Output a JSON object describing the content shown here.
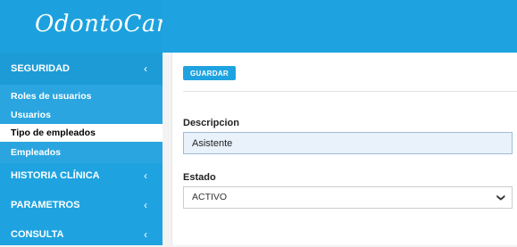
{
  "app": {
    "brand": "OdontoCandy"
  },
  "sidebar": {
    "sections": [
      {
        "label": "SEGURIDAD",
        "chevron": "‹"
      },
      {
        "label": "HISTORIA CLÍNICA",
        "chevron": "‹"
      },
      {
        "label": "PARAMETROS",
        "chevron": "‹"
      },
      {
        "label": "CONSULTA",
        "chevron": "‹"
      }
    ],
    "submenu": [
      {
        "label": "Roles de usuarios",
        "active": false
      },
      {
        "label": "Usuarios",
        "active": false
      },
      {
        "label": "Tipo de empleados",
        "active": true
      },
      {
        "label": "Empleados",
        "active": false
      }
    ]
  },
  "form": {
    "save_label": "GUARDAR",
    "descripcion_label": "Descripcion",
    "descripcion_value": "Asistente",
    "estado_label": "Estado",
    "estado_value": "ACTIVO",
    "estado_caret": "❯"
  },
  "colors": {
    "accent": "#1fa3e0",
    "sidebar_bg": "#1fa3e0",
    "submenu_bg": "#2aa5df",
    "active_item_bg": "#ffffff"
  }
}
